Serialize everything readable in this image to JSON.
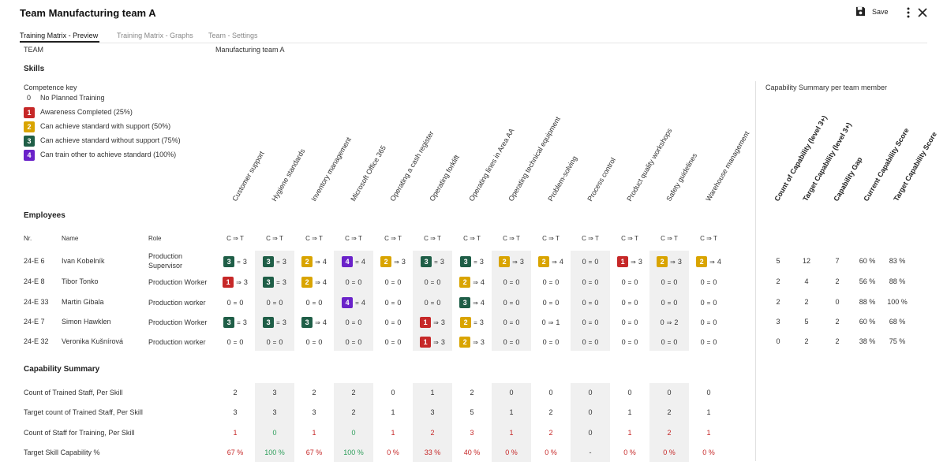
{
  "header": {
    "title": "Team Manufacturing team A",
    "save_label": "Save"
  },
  "tabs": [
    {
      "label": "Training Matrix - Preview",
      "active": true
    },
    {
      "label": "Training Matrix - Graphs",
      "active": false
    },
    {
      "label": "Team - Settings",
      "active": false
    }
  ],
  "team_row": {
    "label": "TEAM",
    "value": "Manufacturing team A"
  },
  "skills_heading": "Skills",
  "competence_key": {
    "title": "Competence key",
    "items": [
      {
        "num": "0",
        "label": "No Planned Training",
        "color": ""
      },
      {
        "num": "1",
        "label": "Awareness Completed (25%)",
        "color": "#c62828"
      },
      {
        "num": "2",
        "label": "Can achieve standard with support (50%)",
        "color": "#d9a400"
      },
      {
        "num": "3",
        "label": "Can achieve standard without support (75%)",
        "color": "#1f5e47"
      },
      {
        "num": "4",
        "label": "Can train other to achieve standard (100%)",
        "color": "#6a22c9"
      }
    ]
  },
  "capability_per_member_title": "Capability Summary per team member",
  "skills": [
    "Customer support",
    "Hygiene standards",
    "Inventory management",
    "Microsoft Office 365",
    "Operating a cash register",
    "Operating forklift",
    "Operating lines in Area AA",
    "Operating technical equipment",
    "Problem-solving",
    "Process control",
    "Product quality workshops",
    "Safety guidelines",
    "Warehouse management"
  ],
  "capability_columns": [
    "Count of Capability (level 3+)",
    "Target Capability (level 3+)",
    "Capability Gap",
    "Current Capability Score",
    "Target Capability Score"
  ],
  "employees_heading": "Employees",
  "emp_headers": {
    "nr": "Nr.",
    "name": "Name",
    "role": "Role",
    "ct": "C ⇒ T"
  },
  "level_colors": {
    "1": "#c62828",
    "2": "#d9a400",
    "3": "#1f5e47",
    "4": "#6a22c9"
  },
  "employees": [
    {
      "nr": "24-E 6",
      "name": "Ivan Kobelník",
      "role": "Production Supervisor",
      "cells": [
        [
          "3",
          "=",
          "3"
        ],
        [
          "3",
          "=",
          "3"
        ],
        [
          "2",
          "⇒",
          "4"
        ],
        [
          "4",
          "=",
          "4"
        ],
        [
          "2",
          "⇒",
          "3"
        ],
        [
          "3",
          "=",
          "3"
        ],
        [
          "3",
          "=",
          "3"
        ],
        [
          "2",
          "⇒",
          "3"
        ],
        [
          "2",
          "⇒",
          "4"
        ],
        [
          "0",
          "=",
          "0"
        ],
        [
          "1",
          "⇒",
          "3"
        ],
        [
          "2",
          "⇒",
          "3"
        ],
        [
          "2",
          "⇒",
          "4"
        ]
      ],
      "cap": [
        "5",
        "12",
        "7",
        "60 %",
        "83 %"
      ]
    },
    {
      "nr": "24-E 8",
      "name": "Tibor Tonko",
      "role": "Production Worker",
      "cells": [
        [
          "1",
          "⇒",
          "3"
        ],
        [
          "3",
          "=",
          "3"
        ],
        [
          "2",
          "⇒",
          "4"
        ],
        [
          "0",
          "=",
          "0"
        ],
        [
          "0",
          "=",
          "0"
        ],
        [
          "0",
          "=",
          "0"
        ],
        [
          "2",
          "⇒",
          "4"
        ],
        [
          "0",
          "=",
          "0"
        ],
        [
          "0",
          "=",
          "0"
        ],
        [
          "0",
          "=",
          "0"
        ],
        [
          "0",
          "=",
          "0"
        ],
        [
          "0",
          "=",
          "0"
        ],
        [
          "0",
          "=",
          "0"
        ]
      ],
      "cap": [
        "2",
        "4",
        "2",
        "56 %",
        "88 %"
      ]
    },
    {
      "nr": "24-E 33",
      "name": "Martin Gibala",
      "role": "Production worker",
      "cells": [
        [
          "0",
          "=",
          "0"
        ],
        [
          "0",
          "=",
          "0"
        ],
        [
          "0",
          "=",
          "0"
        ],
        [
          "4",
          "=",
          "4"
        ],
        [
          "0",
          "=",
          "0"
        ],
        [
          "0",
          "=",
          "0"
        ],
        [
          "3",
          "⇒",
          "4"
        ],
        [
          "0",
          "=",
          "0"
        ],
        [
          "0",
          "=",
          "0"
        ],
        [
          "0",
          "=",
          "0"
        ],
        [
          "0",
          "=",
          "0"
        ],
        [
          "0",
          "=",
          "0"
        ],
        [
          "0",
          "=",
          "0"
        ]
      ],
      "cap": [
        "2",
        "2",
        "0",
        "88 %",
        "100 %"
      ]
    },
    {
      "nr": "24-E 7",
      "name": "Simon Hawklen",
      "role": "Production Worker",
      "cells": [
        [
          "3",
          "=",
          "3"
        ],
        [
          "3",
          "=",
          "3"
        ],
        [
          "3",
          "⇒",
          "4"
        ],
        [
          "0",
          "=",
          "0"
        ],
        [
          "0",
          "=",
          "0"
        ],
        [
          "1",
          "⇒",
          "3"
        ],
        [
          "2",
          "=",
          "3"
        ],
        [
          "0",
          "=",
          "0"
        ],
        [
          "0",
          "⇒",
          "1"
        ],
        [
          "0",
          "=",
          "0"
        ],
        [
          "0",
          "=",
          "0"
        ],
        [
          "0",
          "⇒",
          "2"
        ],
        [
          "0",
          "=",
          "0"
        ]
      ],
      "cap": [
        "3",
        "5",
        "2",
        "60 %",
        "68 %"
      ]
    },
    {
      "nr": "24-E 32",
      "name": "Veronika Kušnírová",
      "role": "Production worker",
      "cells": [
        [
          "0",
          "=",
          "0"
        ],
        [
          "0",
          "=",
          "0"
        ],
        [
          "0",
          "=",
          "0"
        ],
        [
          "0",
          "=",
          "0"
        ],
        [
          "0",
          "=",
          "0"
        ],
        [
          "1",
          "⇒",
          "3"
        ],
        [
          "2",
          "⇒",
          "3"
        ],
        [
          "0",
          "=",
          "0"
        ],
        [
          "0",
          "=",
          "0"
        ],
        [
          "0",
          "=",
          "0"
        ],
        [
          "0",
          "=",
          "0"
        ],
        [
          "0",
          "=",
          "0"
        ],
        [
          "0",
          "=",
          "0"
        ]
      ],
      "cap": [
        "0",
        "2",
        "2",
        "38 %",
        "75 %"
      ]
    }
  ],
  "capability_summary": {
    "heading": "Capability Summary",
    "rows": [
      {
        "label": "Count of Trained Staff, Per Skill",
        "values": [
          "2",
          "3",
          "2",
          "2",
          "0",
          "1",
          "2",
          "0",
          "0",
          "0",
          "0",
          "0",
          "0"
        ],
        "kind": "plain"
      },
      {
        "label": "Target count of Trained Staff, Per Skill",
        "values": [
          "3",
          "3",
          "3",
          "2",
          "1",
          "3",
          "5",
          "1",
          "2",
          "0",
          "1",
          "2",
          "1"
        ],
        "kind": "plain"
      },
      {
        "label": "Count of Staff for Training, Per Skill",
        "values": [
          "1",
          "0",
          "1",
          "0",
          "1",
          "2",
          "3",
          "1",
          "2",
          "0",
          "1",
          "2",
          "1"
        ],
        "kind": "colored"
      },
      {
        "label": "Target Skill Capability %",
        "values": [
          "67 %",
          "100 %",
          "67 %",
          "100 %",
          "0 %",
          "33 %",
          "40 %",
          "0 %",
          "0 %",
          "-",
          "0 %",
          "0 %",
          "0 %"
        ],
        "kind": "colored"
      }
    ],
    "colors": {
      "good": "#2e9e5b",
      "bad": "#c62828",
      "neutral": "#333333"
    }
  }
}
